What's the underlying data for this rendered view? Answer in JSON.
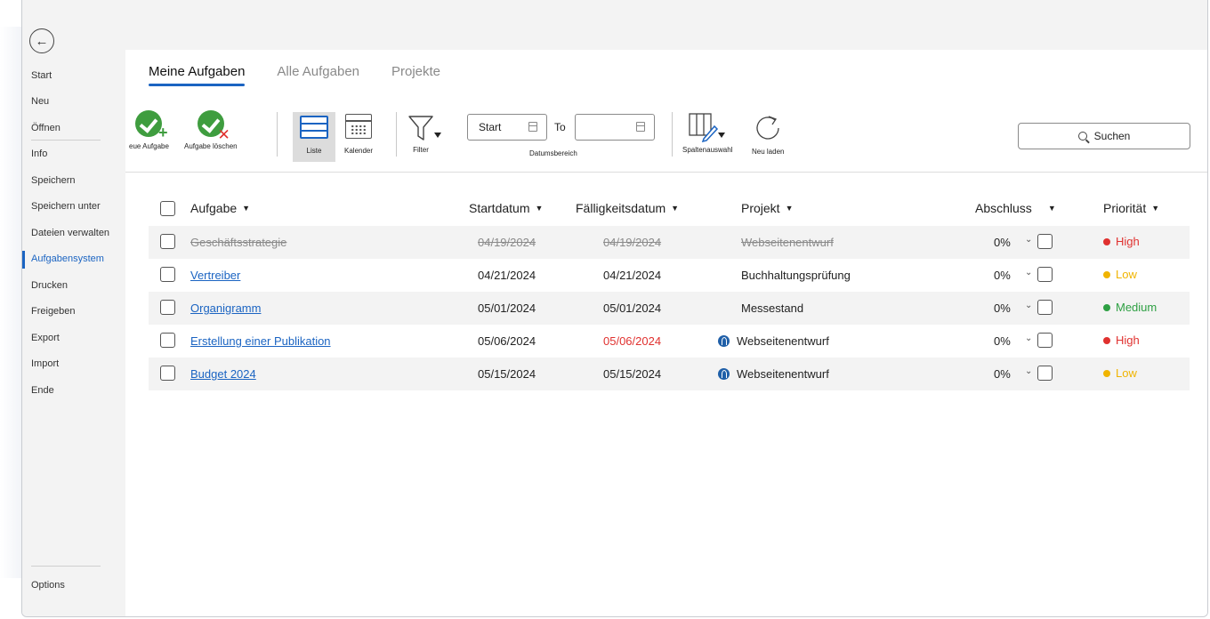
{
  "sidebar": {
    "items": [
      {
        "label": "Start"
      },
      {
        "label": "Neu"
      },
      {
        "label": "Öffnen"
      },
      {
        "label": "Info"
      },
      {
        "label": "Speichern"
      },
      {
        "label": "Speichern unter"
      },
      {
        "label": "Dateien verwalten"
      },
      {
        "label": "Aufgabensystem",
        "active": true
      },
      {
        "label": "Drucken"
      },
      {
        "label": "Freigeben"
      },
      {
        "label": "Export"
      },
      {
        "label": "Import"
      },
      {
        "label": "Ende"
      }
    ],
    "options_label": "Options"
  },
  "tabs": [
    {
      "label": "Meine Aufgaben",
      "active": true
    },
    {
      "label": "Alle Aufgaben"
    },
    {
      "label": "Projekte"
    }
  ],
  "ribbon": {
    "new_task": "eue Aufgabe",
    "delete_task": "Aufgabe löschen",
    "list": "Liste",
    "calendar": "Kalender",
    "filter": "Filter",
    "date_start_placeholder": "Start",
    "to": "To",
    "date_end": "",
    "date_range": "Datumsbereich",
    "columns": "Spaltenauswahl",
    "reload": "Neu laden",
    "search": "Suchen"
  },
  "table": {
    "headers": {
      "task": "Aufgabe",
      "start": "Startdatum",
      "due": "Fälligkeitsdatum",
      "project": "Projekt",
      "completion": "Abschluss",
      "priority": "Priorität"
    },
    "rows": [
      {
        "task": "Geschäftsstrategie",
        "start": "04/19/2024",
        "due": "04/19/2024",
        "project": "Webseitenentwurf",
        "completion": "0%",
        "priority": "High",
        "done": true,
        "overdue": false,
        "project_icon": false
      },
      {
        "task": "Vertreiber",
        "start": "04/21/2024",
        "due": "04/21/2024",
        "project": "Buchhaltungsprüfung",
        "completion": "0%",
        "priority": "Low",
        "done": false,
        "overdue": false,
        "project_icon": false
      },
      {
        "task": "Organigramm",
        "start": "05/01/2024",
        "due": "05/01/2024",
        "project": "Messestand",
        "completion": "0%",
        "priority": "Medium",
        "done": false,
        "overdue": false,
        "project_icon": false
      },
      {
        "task": "Erstellung einer Publikation",
        "start": "05/06/2024",
        "due": "05/06/2024",
        "project": "Webseitenentwurf",
        "completion": "0%",
        "priority": "High",
        "done": false,
        "overdue": true,
        "project_icon": true
      },
      {
        "task": "Budget 2024",
        "start": "05/15/2024",
        "due": "05/15/2024",
        "project": "Webseitenentwurf",
        "completion": "0%",
        "priority": "Low",
        "done": false,
        "overdue": false,
        "project_icon": true
      }
    ]
  },
  "colors": {
    "accent": "#1b64c2",
    "high": "#e0312f",
    "low": "#f0b400",
    "medium": "#2ea043",
    "overdue": "#e0312f"
  }
}
